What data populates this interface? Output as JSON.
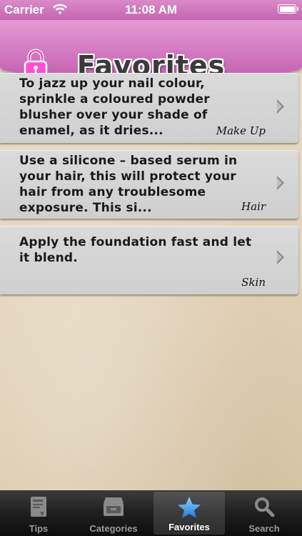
{
  "status_bar": {
    "carrier": "Carrier",
    "time": "11:08 AM"
  },
  "header": {
    "title": "Favorites",
    "lock_icon": "lock-icon"
  },
  "favorites": [
    {
      "text": "To jazz up your nail colour, sprinkle a coloured powder blusher over your shade of enamel, as it dries...",
      "category": "Make Up"
    },
    {
      "text": "Use a silicone – based serum in your hair, this will protect your hair from any troublesome exposure. This si...",
      "category": "Hair"
    },
    {
      "text": "Apply the foundation fast and let it blend.",
      "category": "Skin"
    }
  ],
  "tabs": [
    {
      "label": "Tips",
      "icon": "book-icon"
    },
    {
      "label": "Categories",
      "icon": "drawer-icon"
    },
    {
      "label": "Favorites",
      "icon": "star-icon",
      "active": true
    },
    {
      "label": "Search",
      "icon": "magnifier-icon"
    }
  ],
  "colors": {
    "header_pink": "#d57fc4",
    "accent_blue": "#3a8ee6",
    "tab_bar": "#1f1f1f"
  }
}
